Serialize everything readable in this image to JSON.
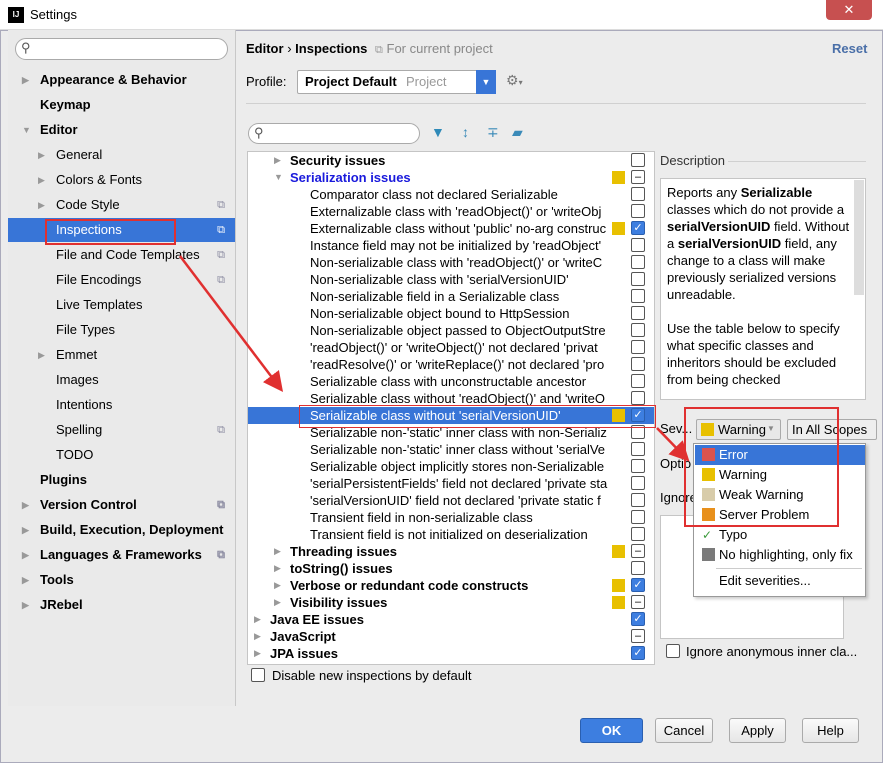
{
  "window": {
    "title": "Settings",
    "close": "✕"
  },
  "sidebar": {
    "items": [
      {
        "label": "Appearance & Behavior",
        "level": 0,
        "arrow": "right",
        "bold": true
      },
      {
        "label": "Keymap",
        "level": 0,
        "bold": true
      },
      {
        "label": "Editor",
        "level": 0,
        "arrow": "down",
        "bold": true
      },
      {
        "label": "General",
        "level": 1,
        "arrow": "right"
      },
      {
        "label": "Colors & Fonts",
        "level": 1,
        "arrow": "right"
      },
      {
        "label": "Code Style",
        "level": 1,
        "arrow": "right",
        "copy": true
      },
      {
        "label": "Inspections",
        "level": 1,
        "selected": true,
        "copy": true
      },
      {
        "label": "File and Code Templates",
        "level": 1,
        "copy": true
      },
      {
        "label": "File Encodings",
        "level": 1,
        "copy": true
      },
      {
        "label": "Live Templates",
        "level": 1
      },
      {
        "label": "File Types",
        "level": 1
      },
      {
        "label": "Emmet",
        "level": 1,
        "arrow": "right"
      },
      {
        "label": "Images",
        "level": 1
      },
      {
        "label": "Intentions",
        "level": 1
      },
      {
        "label": "Spelling",
        "level": 1,
        "copy": true
      },
      {
        "label": "TODO",
        "level": 1
      },
      {
        "label": "Plugins",
        "level": 0,
        "bold": true
      },
      {
        "label": "Version Control",
        "level": 0,
        "arrow": "right",
        "bold": true,
        "copy": true
      },
      {
        "label": "Build, Execution, Deployment",
        "level": 0,
        "arrow": "right",
        "bold": true
      },
      {
        "label": "Languages & Frameworks",
        "level": 0,
        "arrow": "right",
        "bold": true,
        "copy": true
      },
      {
        "label": "Tools",
        "level": 0,
        "arrow": "right",
        "bold": true
      },
      {
        "label": "JRebel",
        "level": 0,
        "arrow": "right",
        "bold": true
      }
    ]
  },
  "header": {
    "breadcrumb_parent": "Editor",
    "breadcrumb_sep": "›",
    "breadcrumb_current": "Inspections",
    "scope_note": "For current project",
    "reset": "Reset"
  },
  "profile": {
    "label": "Profile:",
    "name": "Project Default",
    "kind": "Project"
  },
  "colors": {
    "accent": "#3875d7",
    "warning": "#e8c000",
    "error": "#d9534f",
    "weak_warning": "#d8ccaa",
    "server_problem": "#e8901c",
    "no_highlight": "#7a7a7a",
    "annotation": "#e03030"
  },
  "tree": {
    "rows": [
      {
        "label": "Security issues",
        "level": 1,
        "arrow": "right",
        "bold": true,
        "check": "off"
      },
      {
        "label": "Serialization issues",
        "level": 1,
        "arrow": "down",
        "bold": true,
        "blue": true,
        "sev": "warning",
        "check": "mixed"
      },
      {
        "label": "Comparator class not declared Serializable",
        "level": 2,
        "check": "off"
      },
      {
        "label": "Externalizable class with 'readObject()' or 'writeObj",
        "level": 2,
        "check": "off"
      },
      {
        "label": "Externalizable class without 'public' no-arg construc",
        "level": 2,
        "sev": "warning",
        "check": "on"
      },
      {
        "label": "Instance field may not be initialized by 'readObject'",
        "level": 2,
        "check": "off"
      },
      {
        "label": "Non-serializable class with 'readObject()' or 'writeC",
        "level": 2,
        "check": "off"
      },
      {
        "label": "Non-serializable class with 'serialVersionUID'",
        "level": 2,
        "check": "off"
      },
      {
        "label": "Non-serializable field in a Serializable class",
        "level": 2,
        "check": "off"
      },
      {
        "label": "Non-serializable object bound to HttpSession",
        "level": 2,
        "check": "off"
      },
      {
        "label": "Non-serializable object passed to ObjectOutputStre",
        "level": 2,
        "check": "off"
      },
      {
        "label": "'readObject()' or 'writeObject()' not declared 'privat",
        "level": 2,
        "check": "off"
      },
      {
        "label": "'readResolve()' or 'writeReplace()' not declared 'pro",
        "level": 2,
        "check": "off"
      },
      {
        "label": "Serializable class with unconstructable ancestor",
        "level": 2,
        "check": "off"
      },
      {
        "label": "Serializable class without 'readObject()' and 'writeO",
        "level": 2,
        "check": "off"
      },
      {
        "label": "Serializable class without 'serialVersionUID'",
        "level": 2,
        "sev": "warning",
        "check": "on",
        "selected": true
      },
      {
        "label": "Serializable non-'static' inner class with non-Serializ",
        "level": 2,
        "check": "off"
      },
      {
        "label": "Serializable non-'static' inner class without 'serialVe",
        "level": 2,
        "check": "off"
      },
      {
        "label": "Serializable object implicitly stores non-Serializable",
        "level": 2,
        "check": "off"
      },
      {
        "label": "'serialPersistentFields' field not declared 'private sta",
        "level": 2,
        "check": "off"
      },
      {
        "label": "'serialVersionUID' field not declared 'private static f",
        "level": 2,
        "check": "off"
      },
      {
        "label": "Transient field in non-serializable class",
        "level": 2,
        "check": "off"
      },
      {
        "label": "Transient field is not initialized on deserialization",
        "level": 2,
        "check": "off"
      },
      {
        "label": "Threading issues",
        "level": 1,
        "arrow": "right",
        "bold": true,
        "sev": "warning",
        "check": "mixed"
      },
      {
        "label": "toString() issues",
        "level": 1,
        "arrow": "right",
        "bold": true,
        "check": "off"
      },
      {
        "label": "Verbose or redundant code constructs",
        "level": 1,
        "arrow": "right",
        "bold": true,
        "sev": "warning",
        "check": "on"
      },
      {
        "label": "Visibility issues",
        "level": 1,
        "arrow": "right",
        "bold": true,
        "sev": "warning",
        "check": "mixed"
      },
      {
        "label": "Java EE issues",
        "level": 0,
        "arrow": "right",
        "bold": true,
        "check": "on"
      },
      {
        "label": "JavaScript",
        "level": 0,
        "arrow": "right",
        "bold": true,
        "check": "mixed"
      },
      {
        "label": "JPA issues",
        "level": 0,
        "arrow": "right",
        "bold": true,
        "check": "on"
      }
    ]
  },
  "disable_new": {
    "label": "Disable new inspections by default",
    "checked": false
  },
  "description": {
    "title": "Description",
    "segments": [
      {
        "t": "Reports any "
      },
      {
        "t": "Serializable",
        "b": true
      },
      {
        "t": " classes which do not provide a "
      },
      {
        "t": "serialVersionUID",
        "b": true
      },
      {
        "t": " field. Without a "
      },
      {
        "t": "serialVersionUID",
        "b": true
      },
      {
        "t": " field, any change to a class will make previously serialized versions unreadable."
      },
      {
        "br": true
      },
      {
        "t": "Use the table below to specify what specific classes and inheritors should be excluded from being checked"
      }
    ]
  },
  "severity": {
    "label": "Sev...",
    "value": "Warning",
    "scope": "In All Scopes"
  },
  "options_label": "Optio",
  "ignore_label": "Ignore",
  "ignore_anon": {
    "label": "Ignore anonymous inner cla...",
    "checked": false
  },
  "severity_menu": {
    "items": [
      {
        "label": "Error",
        "color": "error",
        "selected": true
      },
      {
        "label": "Warning",
        "color": "warning"
      },
      {
        "label": "Weak Warning",
        "color": "weak_warning"
      },
      {
        "label": "Server Problem",
        "color": "server_problem"
      },
      {
        "label": "Typo",
        "icon": "typo-icon"
      },
      {
        "label": "No highlighting, only fix",
        "color": "no_highlight"
      }
    ],
    "edit": "Edit severities..."
  },
  "buttons": {
    "ok": "OK",
    "cancel": "Cancel",
    "apply": "Apply",
    "help": "Help"
  }
}
